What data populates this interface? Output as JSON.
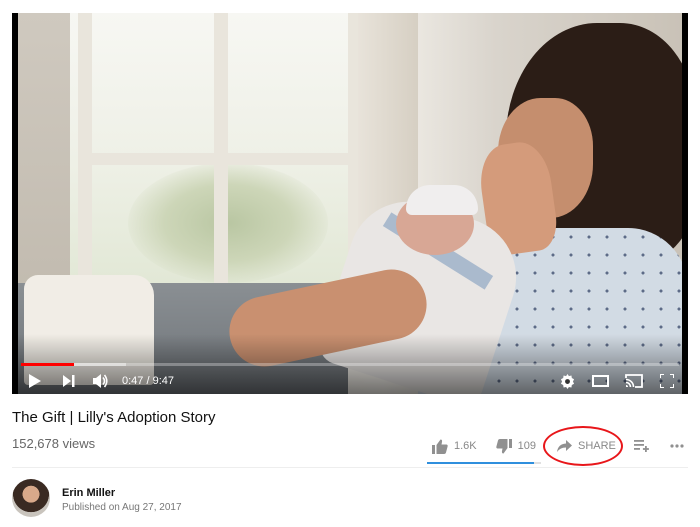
{
  "player": {
    "time_current": "0:47",
    "time_total": "9:47",
    "time_separator": "/",
    "progress_played": 0.08,
    "progress_buffered": 0.16,
    "controls": [
      "play-icon",
      "next-icon",
      "volume-icon",
      "settings-icon",
      "theater-mode-icon",
      "cast-icon",
      "fullscreen-icon"
    ]
  },
  "video": {
    "title": "The Gift | Lilly's Adoption Story",
    "views": "152,678 views"
  },
  "actions": {
    "like_count": "1.6K",
    "dislike_count": "109",
    "share_label": "SHARE",
    "like_ratio": 0.94,
    "icons": [
      "thumbs-up-icon",
      "thumbs-down-icon",
      "share-arrow-icon",
      "add-to-playlist-icon",
      "more-icon"
    ]
  },
  "channel": {
    "name": "Erin Miller",
    "published": "Published on Aug 27, 2017"
  },
  "colors": {
    "progress_played": "#ff0000",
    "like_bar": "#2f8fdd",
    "annotation_circle": "#e8161a"
  }
}
